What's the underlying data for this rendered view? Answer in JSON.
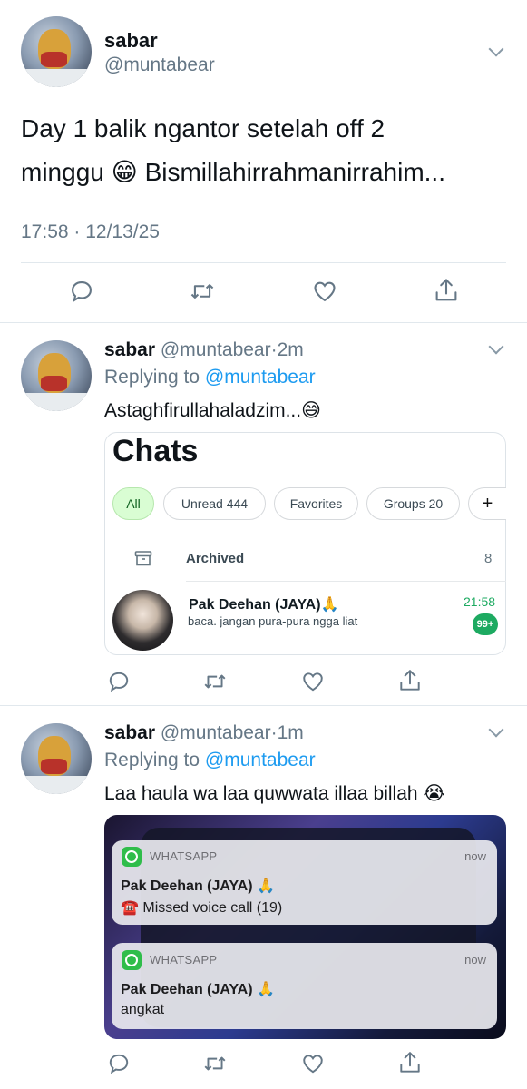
{
  "main_tweet": {
    "display_name": "sabar",
    "handle": "@muntabear",
    "text_line1": "Day 1 balik ngantor setelah off 2",
    "text_line2": "minggu 😁 Bismillahirrahmanirrahim...",
    "timestamp": "17:58 · 12/13/25"
  },
  "replies": [
    {
      "display_name": "sabar",
      "handle": "@muntabear",
      "time": "2m",
      "replying_prefix": "Replying to",
      "replying_to": "@muntabear",
      "text": "Astaghfirullahaladzim...😅",
      "embed": {
        "title": "Chats",
        "filters": [
          "All",
          "Unread 444",
          "Favorites",
          "Groups 20",
          "+"
        ],
        "archived_label": "Archived",
        "archived_count": "8",
        "chat": {
          "name": "Pak Deehan (JAYA)🙏",
          "preview": "baca. jangan pura-pura ngga liat",
          "time": "21:58",
          "unread": "99+"
        }
      }
    },
    {
      "display_name": "sabar",
      "handle": "@muntabear",
      "time": "1m",
      "replying_prefix": "Replying to",
      "replying_to": "@muntabear",
      "text": "Laa haula wa laa quwwata illaa billah 😭",
      "embed": {
        "notifications": [
          {
            "app": "WHATSAPP",
            "time": "now",
            "title": "Pak Deehan (JAYA) 🙏",
            "body": "☎️ Missed voice call (19)"
          },
          {
            "app": "WHATSAPP",
            "time": "now",
            "title": "Pak Deehan (JAYA) 🙏",
            "body": "angkat"
          }
        ]
      }
    }
  ],
  "colors": {
    "link_blue": "#1d9bf0",
    "secondary_gray": "#657786",
    "whatsapp_green": "#25d366",
    "all_pill_bg": "#d9fdd3"
  },
  "icons": [
    "reply-icon",
    "retweet-icon",
    "like-icon",
    "share-icon",
    "chevron-down-icon",
    "archive-icon",
    "whatsapp-icon",
    "plus-icon"
  ]
}
